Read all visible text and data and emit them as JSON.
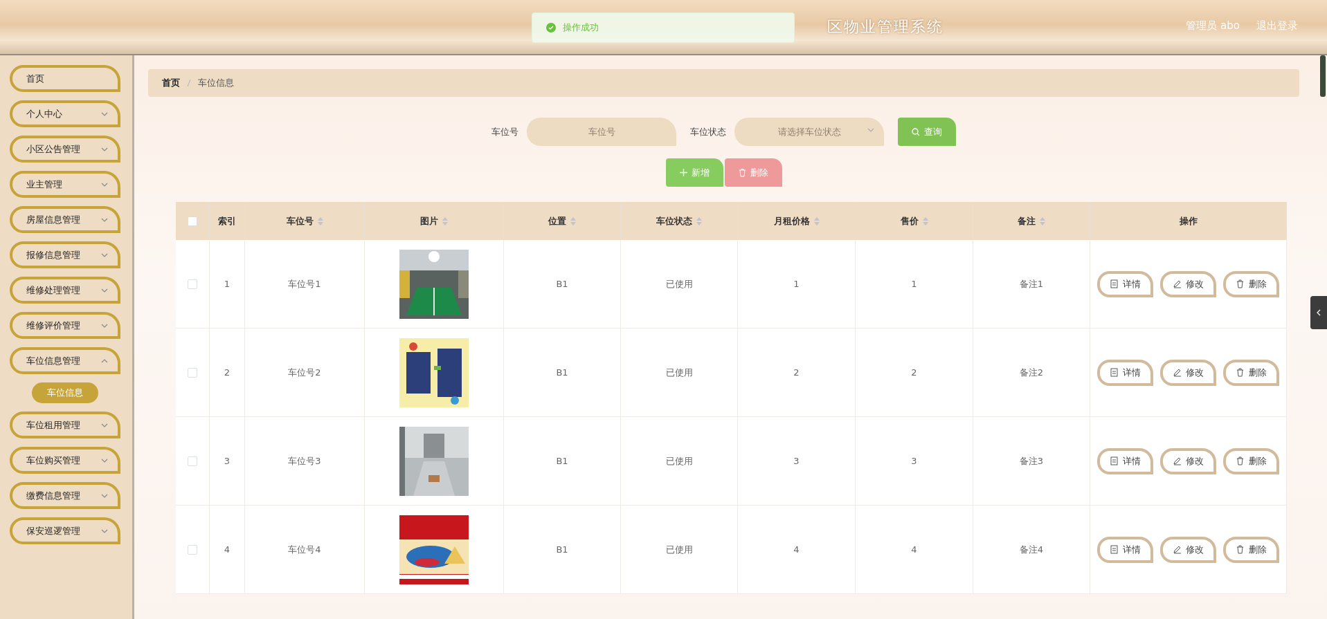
{
  "header": {
    "title": "区物业管理系统",
    "user": "管理员 abo",
    "logout": "退出登录"
  },
  "toast": {
    "text": "操作成功"
  },
  "sidebar": {
    "items": [
      {
        "label": "首页",
        "kind": "link"
      },
      {
        "label": "个人中心",
        "kind": "menu",
        "expanded": false
      },
      {
        "label": "小区公告管理",
        "kind": "menu",
        "expanded": false
      },
      {
        "label": "业主管理",
        "kind": "menu",
        "expanded": false
      },
      {
        "label": "房屋信息管理",
        "kind": "menu",
        "expanded": false
      },
      {
        "label": "报修信息管理",
        "kind": "menu",
        "expanded": false
      },
      {
        "label": "维修处理管理",
        "kind": "menu",
        "expanded": false
      },
      {
        "label": "维修评价管理",
        "kind": "menu",
        "expanded": false
      },
      {
        "label": "车位信息管理",
        "kind": "menu",
        "expanded": true,
        "children": [
          {
            "label": "车位信息",
            "selected": true
          }
        ]
      },
      {
        "label": "车位租用管理",
        "kind": "menu",
        "expanded": false
      },
      {
        "label": "车位购买管理",
        "kind": "menu",
        "expanded": false
      },
      {
        "label": "缴费信息管理",
        "kind": "menu",
        "expanded": false
      },
      {
        "label": "保安巡逻管理",
        "kind": "menu",
        "expanded": false
      }
    ]
  },
  "breadcrumb": [
    "首页",
    "车位信息"
  ],
  "search": {
    "fields": [
      {
        "label": "车位号",
        "kind": "input",
        "placeholder": "车位号"
      },
      {
        "label": "车位状态",
        "kind": "select",
        "placeholder": "请选择车位状态"
      }
    ],
    "button": "查询"
  },
  "actions": [
    {
      "label": "新增",
      "kind": "add",
      "disabled": false
    },
    {
      "label": "删除",
      "kind": "delete",
      "disabled": true
    }
  ],
  "table": {
    "select_all": {
      "checked": false
    },
    "columns": [
      {
        "label": "索引",
        "sortable": false
      },
      {
        "label": "车位号",
        "sortable": true
      },
      {
        "label": "图片",
        "sortable": true
      },
      {
        "label": "位置",
        "sortable": true
      },
      {
        "label": "车位状态",
        "sortable": true
      },
      {
        "label": "月租价格",
        "sortable": true
      },
      {
        "label": "售价",
        "sortable": true
      },
      {
        "label": "备注",
        "sortable": true
      },
      {
        "label": "操作",
        "sortable": false
      }
    ],
    "rows": [
      {
        "checked": false,
        "index": "1",
        "number": "车位号1",
        "picture": {
          "kind": "picture"
        },
        "location": "B1",
        "status": "已使用",
        "rent": "1",
        "price": "1",
        "note": "备注1",
        "actions": [
          "详情",
          "修改",
          "删除"
        ]
      },
      {
        "checked": false,
        "index": "2",
        "number": "车位号2",
        "picture": {
          "kind": "picture"
        },
        "location": "B1",
        "status": "已使用",
        "rent": "2",
        "price": "2",
        "note": "备注2",
        "actions": [
          "详情",
          "修改",
          "删除"
        ]
      },
      {
        "checked": false,
        "index": "3",
        "number": "车位号3",
        "picture": {
          "kind": "picture"
        },
        "location": "B1",
        "status": "已使用",
        "rent": "3",
        "price": "3",
        "note": "备注3",
        "actions": [
          "详情",
          "修改",
          "删除"
        ]
      },
      {
        "checked": false,
        "index": "4",
        "number": "车位号4",
        "picture": {
          "kind": "picture"
        },
        "location": "B1",
        "status": "已使用",
        "rent": "4",
        "price": "4",
        "note": "备注4",
        "actions": [
          "详情",
          "修改",
          "删除"
        ]
      }
    ]
  }
}
